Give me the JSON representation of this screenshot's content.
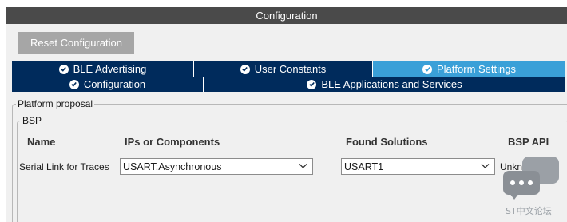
{
  "window": {
    "title": "Configuration"
  },
  "toolbar": {
    "reset_label": "Reset Configuration"
  },
  "tabs_row1": [
    {
      "label": "BLE Advertising",
      "active": false
    },
    {
      "label": "User Constants",
      "active": false
    },
    {
      "label": "Platform Settings",
      "active": true
    }
  ],
  "tabs_row2": [
    {
      "label": "Configuration",
      "active": false
    },
    {
      "label": "BLE Applications and Services",
      "active": false
    }
  ],
  "platform": {
    "legend": "Platform proposal",
    "bsp": {
      "legend": "BSP",
      "columns": {
        "name": "Name",
        "ips": "IPs or Components",
        "solutions": "Found Solutions",
        "api": "BSP API"
      },
      "rows": [
        {
          "name": "Serial Link for Traces",
          "ip": "USART:Asynchronous",
          "solution": "USART1",
          "api": "Unknown"
        }
      ]
    }
  },
  "watermark": {
    "text": "ST中文论坛"
  },
  "colors": {
    "tab_dark": "#002b5c",
    "tab_active": "#3aa0d8",
    "title_bar": "#4a4a4a",
    "button": "#a6a6a6"
  }
}
